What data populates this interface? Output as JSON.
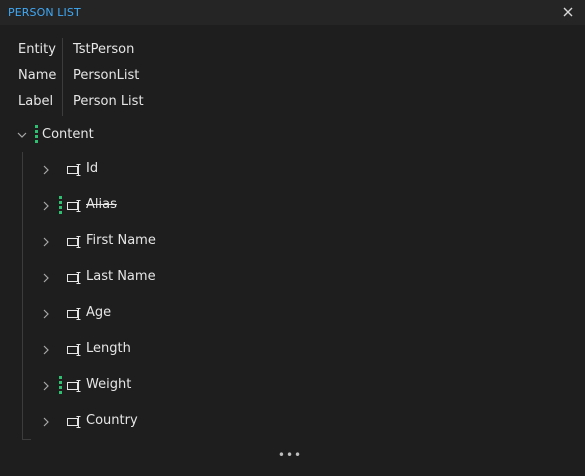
{
  "window": {
    "title": "PERSON LIST",
    "close_icon": "close-icon",
    "accent_color": "#3fa9f5"
  },
  "properties": [
    {
      "key": "Entity",
      "value": "TstPerson"
    },
    {
      "key": "Name",
      "value": "PersonList"
    },
    {
      "key": "Label",
      "value": "Person List"
    }
  ],
  "tree": {
    "root_label": "Content",
    "root_expanded": true,
    "marker_color": "#2fbf71",
    "items": [
      {
        "label": "Id",
        "strikethrough": false,
        "marked": false
      },
      {
        "label": "Alias",
        "strikethrough": true,
        "marked": true
      },
      {
        "label": "First Name",
        "strikethrough": false,
        "marked": false
      },
      {
        "label": "Last Name",
        "strikethrough": false,
        "marked": false
      },
      {
        "label": "Age",
        "strikethrough": false,
        "marked": false
      },
      {
        "label": "Length",
        "strikethrough": false,
        "marked": false
      },
      {
        "label": "Weight",
        "strikethrough": false,
        "marked": true
      },
      {
        "label": "Country",
        "strikethrough": false,
        "marked": false
      }
    ]
  },
  "footer": {
    "more_label": "•••"
  }
}
